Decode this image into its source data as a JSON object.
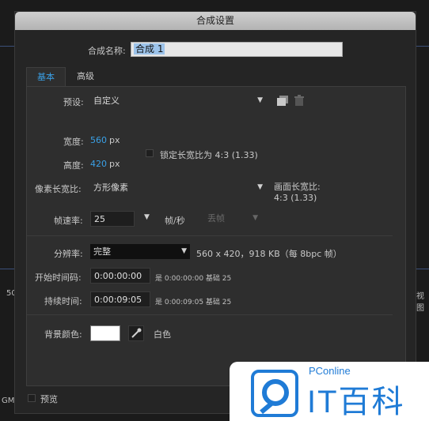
{
  "dialog": {
    "title": "合成设置",
    "comp_name_label": "合成名称:",
    "comp_name_value": "合成 1"
  },
  "tabs": [
    {
      "label": "基本"
    },
    {
      "label": "高级"
    }
  ],
  "basic": {
    "preset_label": "预设:",
    "preset_value": "自定义",
    "width_label": "宽度:",
    "width_value": "560",
    "height_label": "高度:",
    "height_value": "420",
    "px_unit": "px",
    "lock_aspect_label": "锁定长宽比为 4:3 (1.33)",
    "pixel_aspect_label": "像素长宽比:",
    "pixel_aspect_value": "方形像素",
    "frame_aspect_label": "画面长宽比:",
    "frame_aspect_value": "4:3 (1.33)",
    "frame_rate_label": "帧速率:",
    "frame_rate_value": "25",
    "frame_rate_unit": "帧/秒",
    "drop_frame_value": "丢帧",
    "resolution_label": "分辨率:",
    "resolution_value": "完整",
    "resolution_info": "560 x 420，918 KB（每 8bpc 帧）",
    "start_timecode_label": "开始时间码:",
    "start_timecode_value": "0:00:00:00",
    "start_timecode_info": "是 0:00:00:00  基础 25",
    "duration_label": "持续时间:",
    "duration_value": "0:00:09:05",
    "duration_info": "是 0:00:09:05  基础 25",
    "bg_color_label": "背景颜色:",
    "bg_color_name": "白色",
    "bg_color_hex": "#FFFFFF"
  },
  "footer": {
    "preview_label": "预览"
  },
  "background": {
    "left_text_1": "50",
    "left_text_2": "GM",
    "right_text": "视图"
  },
  "watermark": {
    "site": "PConline",
    "brand": "IT百科"
  },
  "colors": {
    "accent": "#3AA0E6",
    "dialog_bg": "#252525",
    "panel_bg": "#2E2E2E"
  }
}
